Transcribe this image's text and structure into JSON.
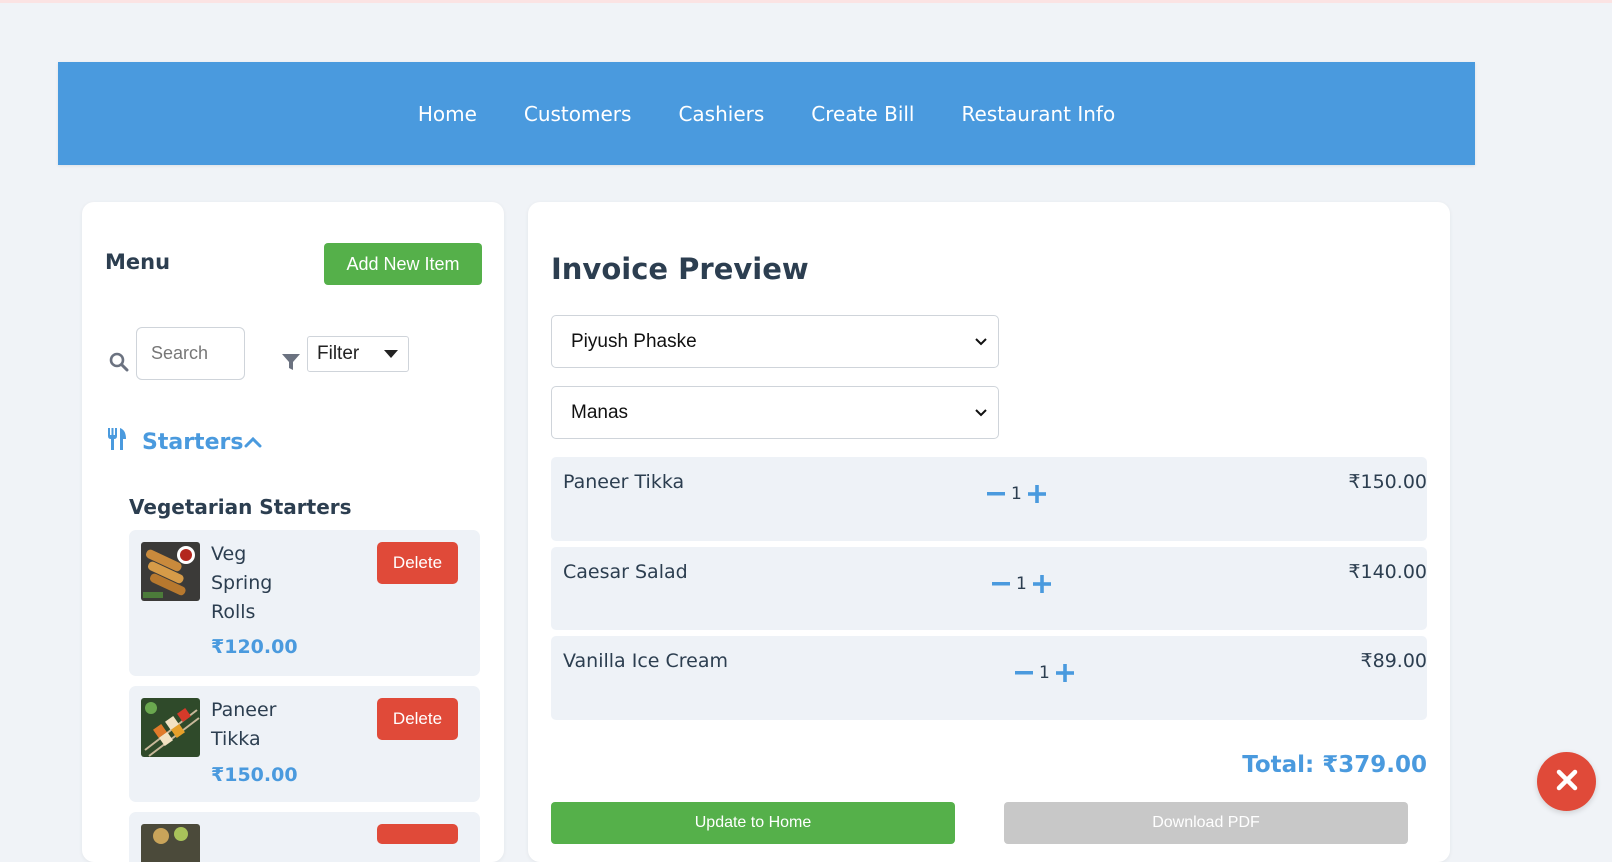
{
  "nav": {
    "links": [
      "Home",
      "Customers",
      "Cashiers",
      "Create Bill",
      "Restaurant Info"
    ]
  },
  "menu": {
    "title": "Menu",
    "add_button": "Add New Item",
    "search_placeholder": "Search",
    "filter_label": "Filter",
    "category": "Starters",
    "subcategory": "Vegetarian Starters",
    "delete_label": "Delete",
    "items": [
      {
        "name": "Veg Spring Rolls",
        "price": "₹120.00"
      },
      {
        "name": "Paneer Tikka",
        "price": "₹150.00"
      }
    ]
  },
  "invoice": {
    "title": "Invoice Preview",
    "customer": "Piyush Phaske",
    "cashier": "Manas",
    "lines": [
      {
        "name": "Paneer Tikka",
        "qty": "1",
        "price": "₹150.00"
      },
      {
        "name": "Caesar Salad",
        "qty": "1",
        "price": "₹140.00"
      },
      {
        "name": "Vanilla Ice Cream",
        "qty": "1",
        "price": "₹89.00"
      }
    ],
    "total": "Total: ₹379.00",
    "update_button": "Update to Home",
    "download_button": "Download PDF"
  },
  "colors": {
    "accent": "#4a9ade",
    "success": "#55b04a",
    "danger": "#e04a39",
    "disabled": "#c8c8c8",
    "background": "#f0f3f7"
  },
  "icons": [
    "search-icon",
    "filter-icon",
    "utensils-icon",
    "chevron-up-icon",
    "minus-icon",
    "plus-icon",
    "close-icon"
  ]
}
